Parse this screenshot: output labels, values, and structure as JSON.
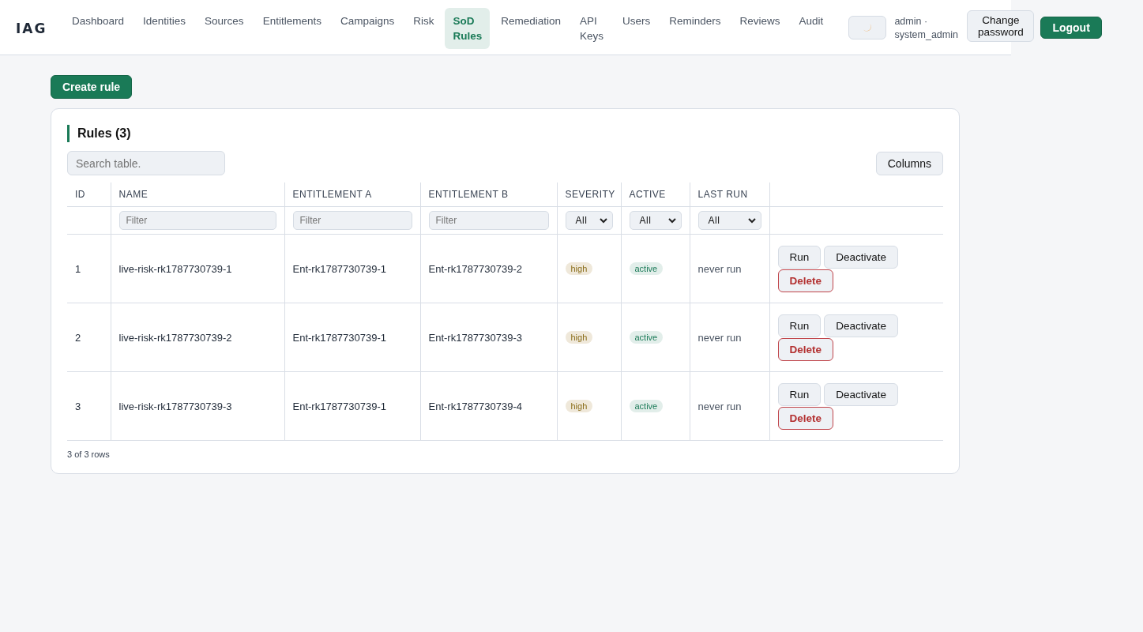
{
  "header": {
    "logo": "IAG",
    "nav": [
      {
        "label": "Dashboard",
        "selected": false
      },
      {
        "label": "Identities",
        "selected": false
      },
      {
        "label": "Sources",
        "selected": false
      },
      {
        "label": "Entitlements",
        "selected": false
      },
      {
        "label": "Campaigns",
        "selected": false
      },
      {
        "label": "Risk",
        "selected": false
      },
      {
        "label": "SoD Rules",
        "selected": true
      },
      {
        "label": "Remediation",
        "selected": false
      },
      {
        "label": "API Keys",
        "selected": false
      },
      {
        "label": "Users",
        "selected": false
      },
      {
        "label": "Reminders",
        "selected": false
      },
      {
        "label": "Reviews",
        "selected": false
      },
      {
        "label": "Audit",
        "selected": false
      }
    ],
    "user": "admin · system_admin",
    "change_password": "Change password",
    "logout": "Logout"
  },
  "create_button": "Create rule",
  "card": {
    "title": "Rules (3)",
    "search": {
      "placeholder": "Search table."
    },
    "columns_button": "Columns",
    "table": {
      "columns": [
        {
          "label": "ID",
          "kind": "plain"
        },
        {
          "label": "NAME",
          "kind": "text",
          "placeholder": "Filter"
        },
        {
          "label": "ENTITLEMENT A",
          "kind": "text",
          "placeholder": "Filter"
        },
        {
          "label": "ENTITLEMENT B",
          "kind": "text",
          "placeholder": "Filter"
        },
        {
          "label": "SEVERITY",
          "kind": "select",
          "value": "All"
        },
        {
          "label": "ACTIVE",
          "kind": "select",
          "value": "All"
        },
        {
          "label": "LAST RUN",
          "kind": "select",
          "value": "All"
        },
        {
          "kind": "plain"
        }
      ],
      "rows": [
        {
          "id": "1",
          "name": "live-risk-rk1787730739-1",
          "ent_a": "Ent-rk1787730739-1",
          "ent_b": "Ent-rk1787730739-2",
          "severity": "high",
          "active": "active",
          "last_run": "never run",
          "actions": [
            "Run",
            "Deactivate",
            "Delete"
          ]
        },
        {
          "id": "2",
          "name": "live-risk-rk1787730739-2",
          "ent_a": "Ent-rk1787730739-1",
          "ent_b": "Ent-rk1787730739-3",
          "severity": "high",
          "active": "active",
          "last_run": "never run",
          "actions": [
            "Run",
            "Deactivate",
            "Delete"
          ]
        },
        {
          "id": "3",
          "name": "live-risk-rk1787730739-3",
          "ent_a": "Ent-rk1787730739-1",
          "ent_b": "Ent-rk1787730739-4",
          "severity": "high",
          "active": "active",
          "last_run": "never run",
          "actions": [
            "Run",
            "Deactivate",
            "Delete"
          ]
        }
      ]
    },
    "footer": "3 of 3 rows"
  }
}
